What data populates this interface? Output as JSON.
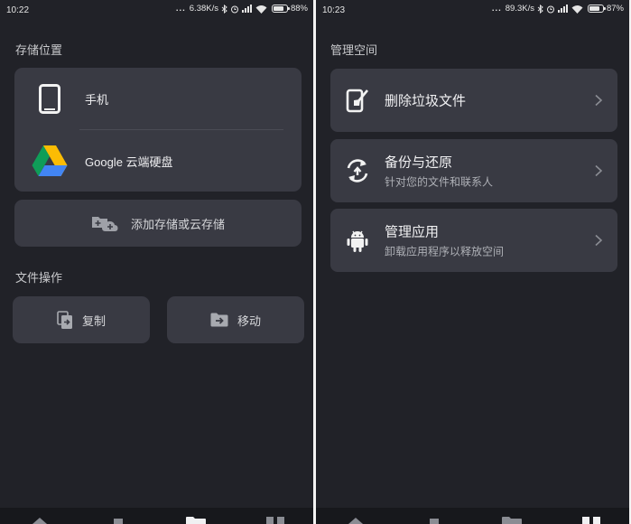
{
  "left_screen": {
    "status": {
      "time": "10:22",
      "speed": "6.38K/s",
      "battery": "88%",
      "battery_level": 0.88
    },
    "storage": {
      "title": "存储位置",
      "items": [
        {
          "label": "手机",
          "icon": "phone-icon"
        },
        {
          "label": "Google 云端硬盘",
          "icon": "google-drive-icon"
        }
      ],
      "add_label": "添加存储或云存储"
    },
    "file_ops": {
      "title": "文件操作",
      "copy_label": "复制",
      "move_label": "移动"
    }
  },
  "right_screen": {
    "status": {
      "time": "10:23",
      "speed": "89.3K/s",
      "battery": "87%",
      "battery_level": 0.87
    },
    "manage": {
      "title": "管理空间",
      "items": [
        {
          "title": "删除垃圾文件",
          "subtitle": "",
          "icon": "clean-phone-icon"
        },
        {
          "title": "备份与还原",
          "subtitle": "针对您的文件和联系人",
          "icon": "backup-restore-icon"
        },
        {
          "title": "管理应用",
          "subtitle": "卸载应用程序以释放空间",
          "icon": "android-icon"
        }
      ]
    }
  },
  "colors": {
    "background": "#212228",
    "card": "#393a43",
    "text": "#eeeef0",
    "subtext": "#aeb0b6"
  }
}
